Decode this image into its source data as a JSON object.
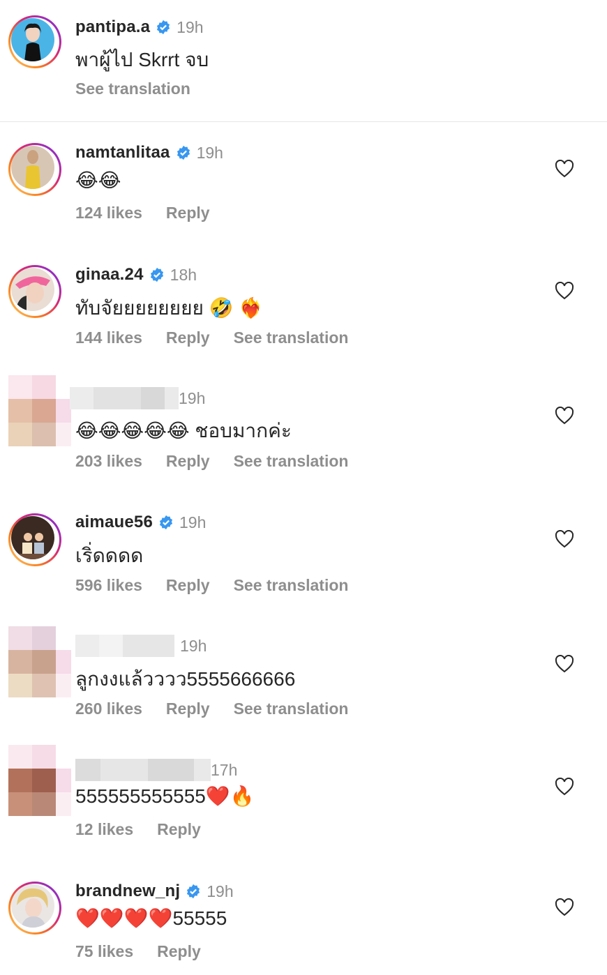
{
  "comments": [
    {
      "username": "pantipa.a",
      "time": "19h",
      "text": "พาผู้ไป Skrrt จบ",
      "actions": {
        "see_translation": "See translation"
      }
    },
    {
      "username": "namtanlitaa",
      "time": "19h",
      "text": "😂😂",
      "actions": {
        "likes": "124 likes",
        "reply": "Reply"
      }
    },
    {
      "username": "ginaa.24",
      "time": "18h",
      "text": "ทับจัยยยยยยยย 🤣 ❤️‍🔥",
      "actions": {
        "likes": "144 likes",
        "reply": "Reply",
        "see_translation": "See translation"
      }
    },
    {
      "username": "",
      "time": "19h",
      "text": "😂😂😂😂😂 ชอบมากค่ะ",
      "actions": {
        "likes": "203 likes",
        "reply": "Reply",
        "see_translation": "See translation"
      }
    },
    {
      "username": "aimaue56",
      "time": "19h",
      "text": "เริ่ดดดด",
      "actions": {
        "likes": "596 likes",
        "reply": "Reply",
        "see_translation": "See translation"
      }
    },
    {
      "username": "",
      "time": "19h",
      "text": "ลูกงงแล้วววว5555666666",
      "actions": {
        "likes": "260 likes",
        "reply": "Reply",
        "see_translation": "See translation"
      }
    },
    {
      "username": "",
      "time": "17h",
      "text": "555555555555❤️🔥",
      "actions": {
        "likes": "12 likes",
        "reply": "Reply"
      }
    },
    {
      "username": "brandnew_nj",
      "time": "19h",
      "text": "❤️❤️❤️❤️55555",
      "actions": {
        "likes": "75 likes",
        "reply": "Reply"
      }
    }
  ],
  "colors": {
    "verified": "#3897f0",
    "secondary": "#8e8e8e",
    "primary": "#262626"
  },
  "icons": {
    "like": "heart-outline-icon",
    "verified": "verified-badge-icon"
  }
}
